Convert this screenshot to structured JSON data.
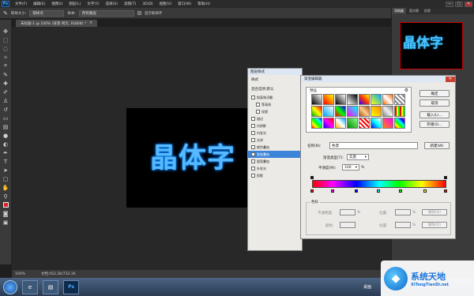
{
  "app": {
    "logo": "Ps",
    "menus": [
      "文件(F)",
      "编辑(E)",
      "图像(I)",
      "图层(L)",
      "文字(Y)",
      "选择(S)",
      "滤镜(T)",
      "3D(D)",
      "视图(V)",
      "窗口(W)",
      "帮助(H)"
    ],
    "window_controls": [
      "—",
      "□",
      "✕"
    ]
  },
  "options_bar": {
    "size_label": "取样大小:",
    "size_value": "取样点",
    "sample_label": "样本:",
    "sample_value": "所有图层",
    "show_ring_label": "显示取样环"
  },
  "document": {
    "tab_title": "未标题-1 @ 100% (背景 拷贝, RGB/8) *",
    "art_text": "晶体字",
    "zoom": "100%",
    "doc_size": "文档:452.2K/733.1K"
  },
  "right_panel": {
    "tabs": [
      "导航器",
      "直方图",
      "信息"
    ],
    "thumb_text": "晶体字"
  },
  "layer_style": {
    "title": "图层样式",
    "head_style": "样式",
    "head_blend": "混合选项:默认",
    "items": [
      {
        "label": "斜面和浮雕",
        "checked": false
      },
      {
        "label": "等高线",
        "checked": false
      },
      {
        "label": "纹理",
        "checked": false
      },
      {
        "label": "描边",
        "checked": false
      },
      {
        "label": "内阴影",
        "checked": false
      },
      {
        "label": "内发光",
        "checked": false
      },
      {
        "label": "光泽",
        "checked": false
      },
      {
        "label": "颜色叠加",
        "checked": false
      },
      {
        "label": "渐变叠加",
        "checked": true,
        "active": true
      },
      {
        "label": "图案叠加",
        "checked": false
      },
      {
        "label": "外发光",
        "checked": false
      },
      {
        "label": "投影",
        "checked": false
      }
    ]
  },
  "gradient_editor": {
    "title": "渐变编辑器",
    "presets_label": "预设",
    "ok": "确定",
    "cancel": "取消",
    "load": "载入(L)...",
    "save": "存储(S)...",
    "name_label": "名称(N):",
    "name_value": "色谱",
    "new_button": "新建(W)",
    "type_label": "渐变类型(T):",
    "type_value": "实底",
    "smooth_label": "平滑度(M):",
    "smooth_value": "100",
    "smooth_unit": "%",
    "stops_label": "色标",
    "opacity_label": "不透明度:",
    "location_label": "位置:",
    "delete_label": "删除(D)",
    "color_label": "颜色:",
    "percent_unit": "%"
  },
  "taskbar": {
    "ps_label": "Ps",
    "desktop_label": "桌面"
  },
  "watermark": {
    "main": "系统天地",
    "sub": "XiTongTianDi.net"
  },
  "colors": {
    "accent": "#3b84d8",
    "art_text": "#59b8ff",
    "foreground_swatch": "#e02020"
  }
}
